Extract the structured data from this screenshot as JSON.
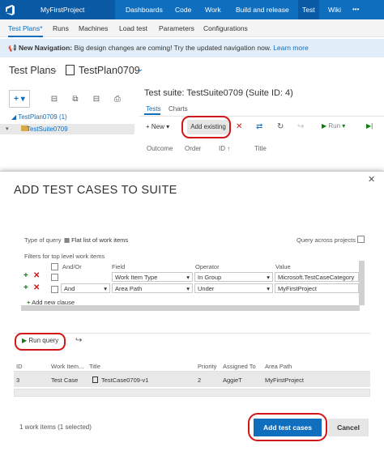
{
  "topbar": {
    "project": "MyFirstProject",
    "items": [
      "Dashboards",
      "Code",
      "Work",
      "Build and release",
      "Test",
      "Wiki"
    ]
  },
  "subnav": {
    "items": [
      "Test Plans*",
      "Runs",
      "Machines",
      "Load test",
      "Parameters",
      "Configurations"
    ]
  },
  "banner": {
    "bold": "New Navigation:",
    "text": "Big design changes are coming! Try the updated navigation now.",
    "link": "Learn more"
  },
  "header": {
    "crumb1": "Test Plans",
    "crumb2": "TestPlan0709"
  },
  "tree": {
    "plan": "TestPlan0709 (1)",
    "suite": "TestSuite0709"
  },
  "right": {
    "suite_title": "Test suite: TestSuite0709 (Suite ID: 4)",
    "tabs": [
      "Tests",
      "Charts"
    ],
    "new_label": "New",
    "add_existing": "Add existing",
    "run_label": "Run",
    "columns": [
      "Outcome",
      "Order",
      "ID",
      "Title"
    ]
  },
  "dialog": {
    "title": "ADD TEST CASES TO SUITE",
    "query_type_label": "Type of query",
    "query_type_value": "Flat list of work items",
    "query_across": "Query across projects",
    "filters_label": "Filters for top level work items",
    "headers": {
      "andor": "And/Or",
      "field": "Field",
      "operator": "Operator",
      "value": "Value"
    },
    "clauses": [
      {
        "andor": "",
        "field": "Work Item Type",
        "operator": "In Group",
        "value": "Microsoft.TestCaseCategory"
      },
      {
        "andor": "And",
        "field": "Area Path",
        "operator": "Under",
        "value": "MyFirstProject"
      }
    ],
    "add_clause": "Add new clause",
    "run_query": "Run query",
    "result_headers": [
      "ID",
      "Work Item...",
      "Title",
      "Priority",
      "Assigned To",
      "Area Path"
    ],
    "results": [
      {
        "id": "3",
        "type": "Test Case",
        "title": "TestCase0709-v1",
        "priority": "2",
        "assigned": "AggieT",
        "area": "MyFirstProject"
      }
    ],
    "status": "1 work items (1 selected)",
    "add_button": "Add test cases",
    "cancel_button": "Cancel"
  },
  "colors": {
    "brand": "#106ebe",
    "highlight": "#d41616"
  }
}
